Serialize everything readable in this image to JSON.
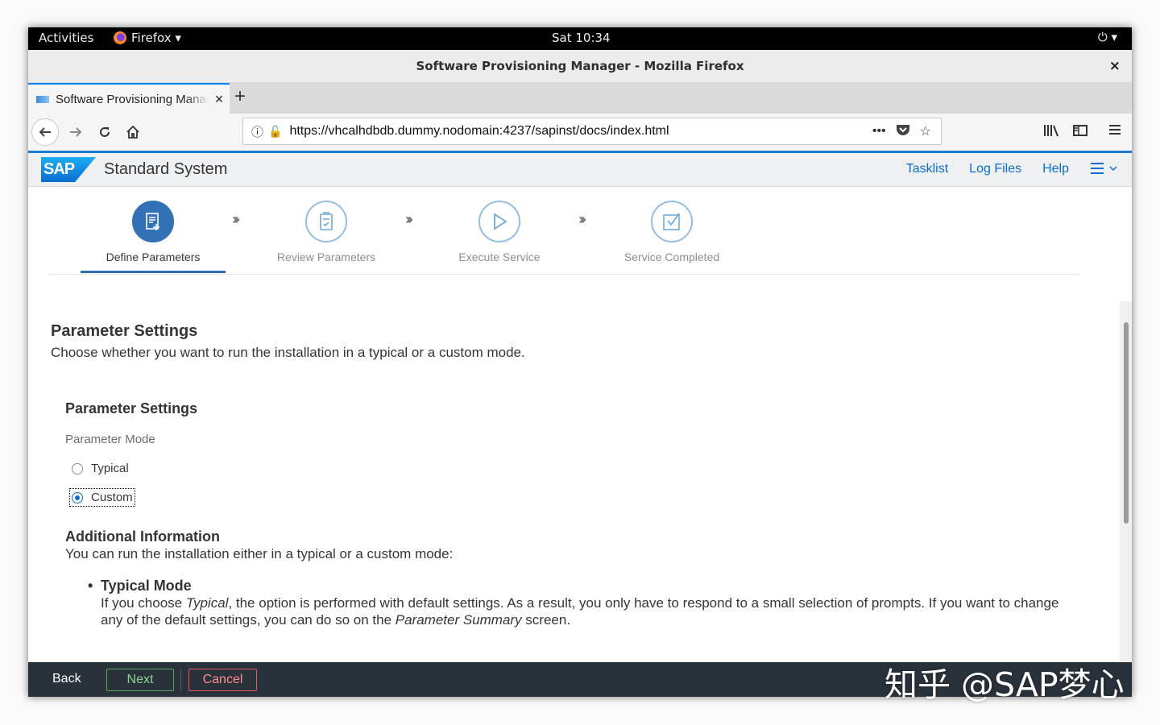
{
  "topbar": {
    "activities": "Activities",
    "app_menu": "Firefox ▾",
    "clock": "Sat 10:34",
    "system_menu": "⏻ ▾"
  },
  "window": {
    "title": "Software Provisioning Manager - Mozilla Firefox",
    "close": "×"
  },
  "tab": {
    "title": "Software Provisioning Manager",
    "close": "×",
    "new_tab": "+"
  },
  "nav": {
    "url": "https://vhcalhdbdb.dummy.nodomain:4237/sapinst/docs/index.html",
    "page_actions": "•••"
  },
  "shell": {
    "logo": "SAP",
    "logo_reg": "®",
    "title": "Standard System",
    "links": [
      "Tasklist",
      "Log Files",
      "Help"
    ]
  },
  "steps": [
    {
      "label": "Define Parameters",
      "active": true,
      "icon": "document-add-icon"
    },
    {
      "label": "Review Parameters",
      "active": false,
      "icon": "clipboard-icon"
    },
    {
      "label": "Execute Service",
      "active": false,
      "icon": "play-icon"
    },
    {
      "label": "Service Completed",
      "active": false,
      "icon": "check-icon"
    }
  ],
  "step_separator": "›››",
  "content": {
    "heading": "Parameter Settings",
    "intro": "Choose whether you want to run the installation in a typical or a custom mode.",
    "section_heading": "Parameter Settings",
    "mode_label": "Parameter Mode",
    "options": [
      {
        "label": "Typical",
        "selected": false
      },
      {
        "label": "Custom",
        "selected": true
      }
    ],
    "info_heading": "Additional Information",
    "info_text": "You can run the installation either in a typical or a custom mode:",
    "bullet_title": "Typical Mode",
    "bullet_text_1": "If you choose ",
    "bullet_em_1": "Typical",
    "bullet_text_2": ", the option is performed with default settings. As a result, you only have to respond to a small selection of prompts. If you want to change any of the default settings, you can do so on the ",
    "bullet_em_2": "Parameter Summary",
    "bullet_text_3": " screen."
  },
  "footer": {
    "back": "Back",
    "next": "Next",
    "cancel": "Cancel"
  },
  "watermark": "知乎 @SAP梦心",
  "colors": {
    "accent": "#0a6ed1",
    "active_step": "#3271b5",
    "footer_bg": "#29313a",
    "next_border": "#5ca35e",
    "cancel_border": "#e05a5a"
  }
}
